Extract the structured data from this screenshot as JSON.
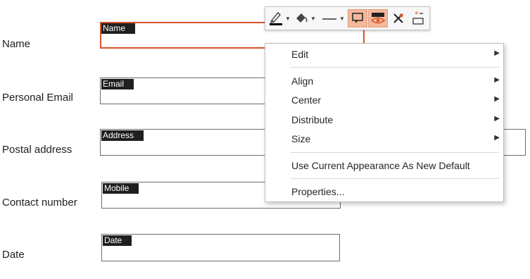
{
  "form": {
    "rows": [
      {
        "label": "Name",
        "tag": "Name"
      },
      {
        "label": "Personal Email",
        "tag": "Email"
      },
      {
        "label": "Postal address",
        "tag": "Address"
      },
      {
        "label": "Contact number",
        "tag": "Mobile"
      },
      {
        "label": "Date",
        "tag": "Date"
      }
    ]
  },
  "toolbar": {
    "items": [
      {
        "icon": "pen-color-icon",
        "has_dropdown": true
      },
      {
        "icon": "fill-color-icon",
        "has_dropdown": true
      },
      {
        "icon": "line-style-icon",
        "has_dropdown": true
      },
      {
        "icon": "field-appearance-icon",
        "active": true
      },
      {
        "icon": "visibility-icon",
        "active": true
      },
      {
        "icon": "clear-pin-icon"
      },
      {
        "icon": "required-field-icon"
      }
    ],
    "accent_color": "#d7542a"
  },
  "context_menu": {
    "edit": "Edit",
    "align": "Align",
    "center": "Center",
    "distribute": "Distribute",
    "size": "Size",
    "use_default": "Use Current Appearance As New Default",
    "properties": "Properties..."
  }
}
